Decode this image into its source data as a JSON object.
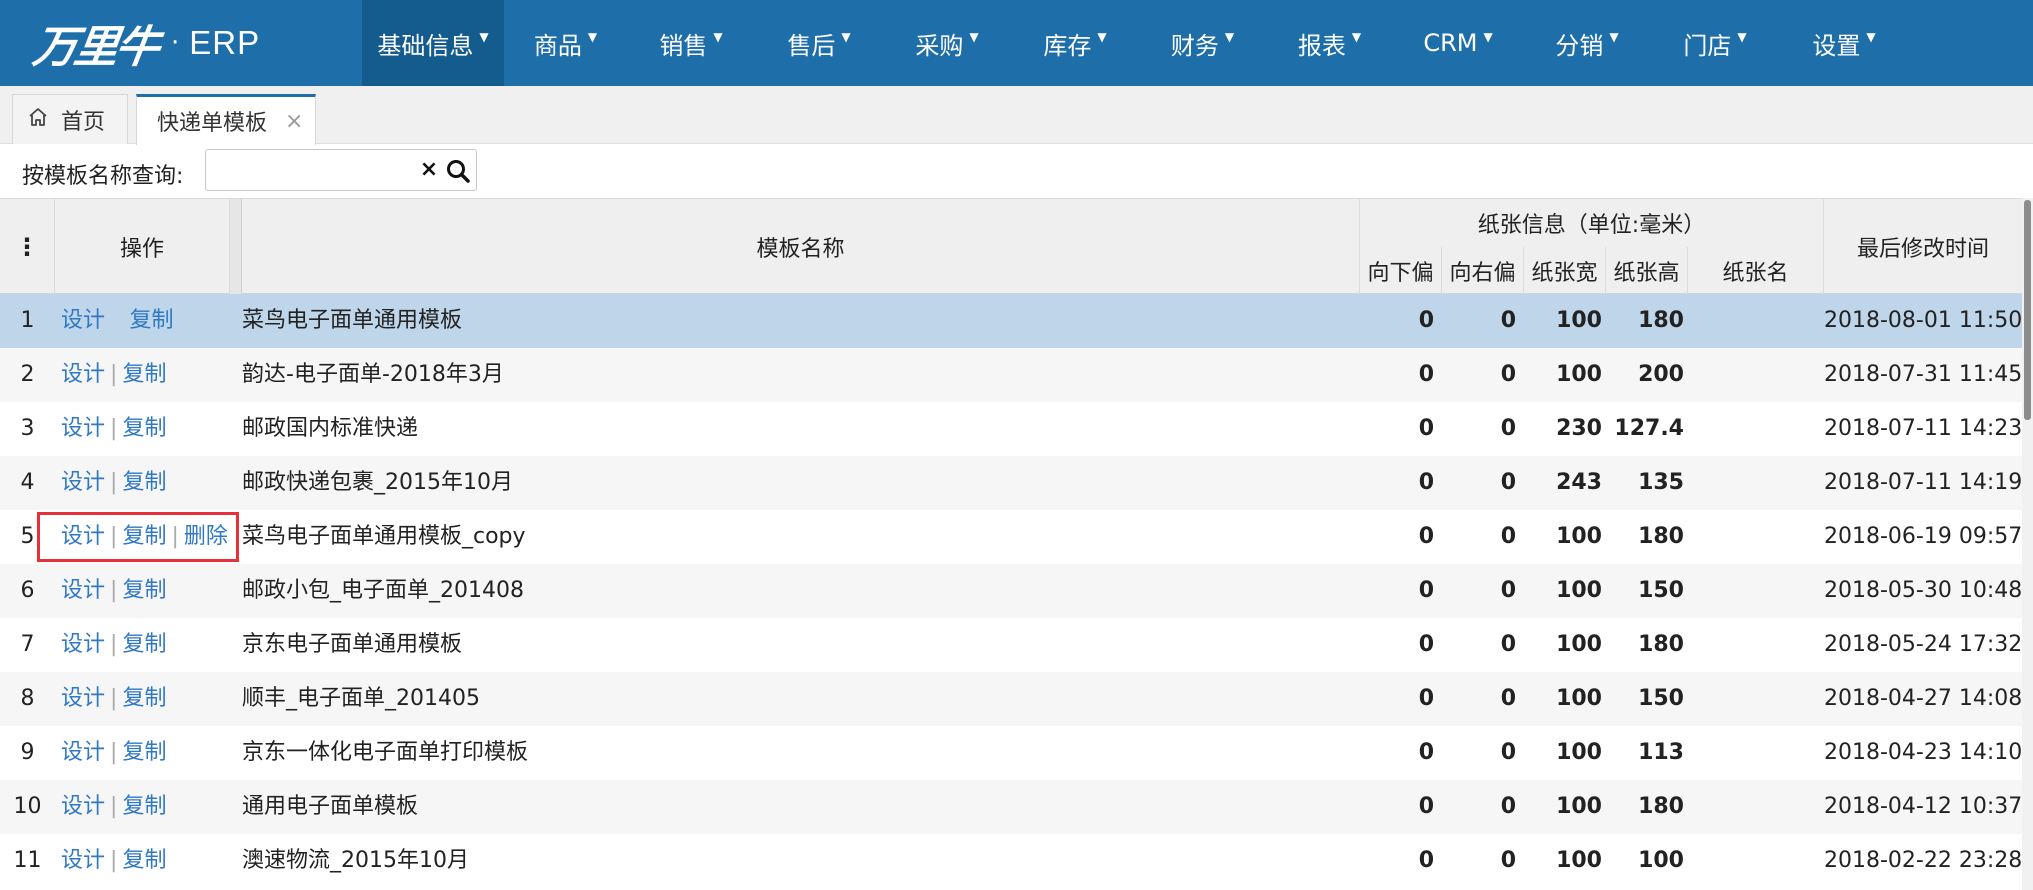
{
  "brand": {
    "logo_text": "万里牛",
    "dot": "·",
    "product": "ERP"
  },
  "nav": [
    {
      "label": "基础信息",
      "active": true
    },
    {
      "label": "商品"
    },
    {
      "label": "销售"
    },
    {
      "label": "售后"
    },
    {
      "label": "采购"
    },
    {
      "label": "库存"
    },
    {
      "label": "财务"
    },
    {
      "label": "报表"
    },
    {
      "label": "CRM"
    },
    {
      "label": "分销"
    },
    {
      "label": "门店"
    },
    {
      "label": "设置"
    }
  ],
  "tabs": {
    "home": "首页",
    "current": "快递单模板",
    "close": "×"
  },
  "search": {
    "label": "按模板名称查询:",
    "value": "",
    "placeholder": "",
    "clear": "×"
  },
  "table": {
    "headers": {
      "menu": "⋮",
      "operation": "操作",
      "name": "模板名称",
      "paper_group": "纸张信息（单位:毫米）",
      "down": "向下偏",
      "right": "向右偏",
      "width": "纸张宽",
      "height": "纸张高",
      "paper_name": "纸张名",
      "modified": "最后修改时间"
    },
    "ops": {
      "design": "设计",
      "copy": "复制",
      "delete": "删除",
      "sep": "|"
    },
    "rows": [
      {
        "idx": "1",
        "name": "菜鸟电子面单通用模板",
        "down": "0",
        "right": "0",
        "width": "100",
        "height": "180",
        "paper_name": "",
        "modified": "2018-08-01 11:50",
        "selected": true
      },
      {
        "idx": "2",
        "name": "韵达-电子面单-2018年3月",
        "down": "0",
        "right": "0",
        "width": "100",
        "height": "200",
        "paper_name": "",
        "modified": "2018-07-31 11:45"
      },
      {
        "idx": "3",
        "name": "邮政国内标准快递",
        "down": "0",
        "right": "0",
        "width": "230",
        "height": "127.4",
        "paper_name": "",
        "modified": "2018-07-11 14:23"
      },
      {
        "idx": "4",
        "name": "邮政快递包裹_2015年10月",
        "down": "0",
        "right": "0",
        "width": "243",
        "height": "135",
        "paper_name": "",
        "modified": "2018-07-11 14:19"
      },
      {
        "idx": "5",
        "name": "菜鸟电子面单通用模板_copy",
        "down": "0",
        "right": "0",
        "width": "100",
        "height": "180",
        "paper_name": "",
        "modified": "2018-06-19 09:57",
        "deletable": true
      },
      {
        "idx": "6",
        "name": "邮政小包_电子面单_201408",
        "down": "0",
        "right": "0",
        "width": "100",
        "height": "150",
        "paper_name": "",
        "modified": "2018-05-30 10:48"
      },
      {
        "idx": "7",
        "name": "京东电子面单通用模板",
        "down": "0",
        "right": "0",
        "width": "100",
        "height": "180",
        "paper_name": "",
        "modified": "2018-05-24 17:32"
      },
      {
        "idx": "8",
        "name": "顺丰_电子面单_201405",
        "down": "0",
        "right": "0",
        "width": "100",
        "height": "150",
        "paper_name": "",
        "modified": "2018-04-27 14:08"
      },
      {
        "idx": "9",
        "name": "京东一体化电子面单打印模板",
        "down": "0",
        "right": "0",
        "width": "100",
        "height": "113",
        "paper_name": "",
        "modified": "2018-04-23 14:10"
      },
      {
        "idx": "10",
        "name": "通用电子面单模板",
        "down": "0",
        "right": "0",
        "width": "100",
        "height": "180",
        "paper_name": "",
        "modified": "2018-04-12 10:37"
      },
      {
        "idx": "11",
        "name": "澳速物流_2015年10月",
        "down": "0",
        "right": "0",
        "width": "100",
        "height": "100",
        "paper_name": "",
        "modified": "2018-02-22 23:28"
      }
    ]
  },
  "colors": {
    "nav_bg": "#1e6fa9",
    "nav_active": "#155c8e",
    "link": "#2f78c4",
    "selected_row": "#bed5ea",
    "highlight": "#e8303a"
  }
}
